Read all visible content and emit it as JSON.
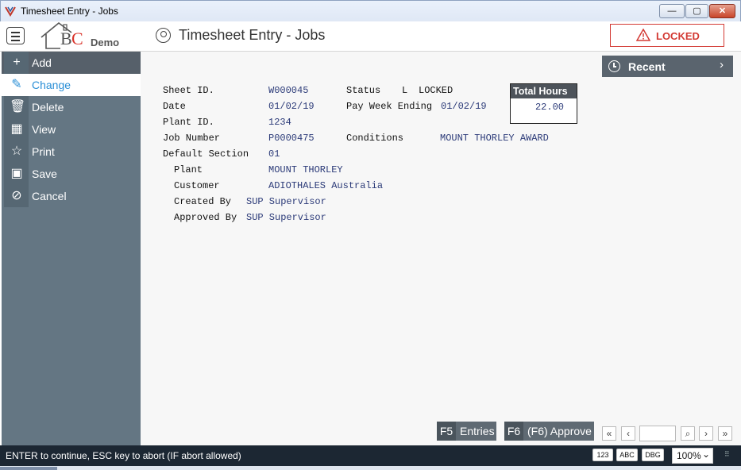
{
  "window": {
    "title": "Timesheet Entry - Jobs",
    "min_glyph": "—",
    "max_glyph": "▢",
    "close_glyph": "✕"
  },
  "header": {
    "logo_b": "B",
    "logo_c": "C",
    "demo": "Demo",
    "title": "Timesheet Entry - Jobs",
    "status_badge": "LOCKED",
    "accent_color": "#d33a34"
  },
  "sidebar": {
    "items": [
      {
        "label": "Add",
        "icon": "+"
      },
      {
        "label": "Change",
        "icon": "✎"
      },
      {
        "label": "Delete",
        "icon": "🗑"
      },
      {
        "label": "View",
        "icon": "▦"
      },
      {
        "label": "Print",
        "icon": "☆"
      },
      {
        "label": "Save",
        "icon": "▣"
      },
      {
        "label": "Cancel",
        "icon": "⊘"
      }
    ],
    "active_color": "#2a8fd6"
  },
  "recent": {
    "label": "Recent",
    "chevron": "›"
  },
  "form": {
    "sheet_id_label": "Sheet ID.",
    "sheet_id": "W000045",
    "status_label": "Status",
    "status_code": "L",
    "status_text": "LOCKED",
    "date_label": "Date",
    "date": "01/02/19",
    "pay_week_label": "Pay Week Ending",
    "pay_week": "01/02/19",
    "plant_id_label": "Plant ID.",
    "plant_id": "1234",
    "job_number_label": "Job Number",
    "job_number": "P0000475",
    "conditions_label": "Conditions",
    "conditions": "MOUNT THORLEY AWARD",
    "default_section_label": "Default Section",
    "default_section": "01",
    "plant_label": "Plant",
    "plant": "MOUNT THORLEY",
    "customer_label": "Customer",
    "customer": "ADIOTHALES Australia",
    "created_by_label": "Created By",
    "created_by": "SUP Supervisor",
    "approved_by_label": "Approved By",
    "approved_by": "SUP Supervisor",
    "total_hours_label": "Total Hours",
    "total_hours": "22.00"
  },
  "actions": {
    "f5_key": "F5",
    "f5_label": "Entries",
    "f6_key": "F6",
    "f6_label": "(F6) Approve"
  },
  "navigation": {
    "first": "«",
    "prev": "‹",
    "search": "⌕",
    "next": "›",
    "last": "»"
  },
  "statusbar": {
    "message": "ENTER to continue, ESC key to abort (IF abort allowed)",
    "btn_123": "123",
    "btn_abc": "ABC",
    "btn_dbg": "DBG",
    "zoom": "100%",
    "zoom_chevron": "⌄"
  }
}
